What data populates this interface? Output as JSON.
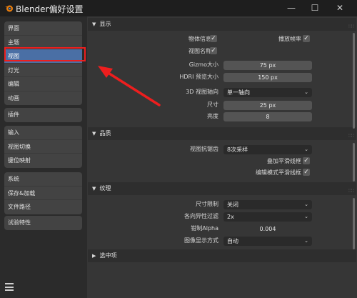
{
  "window": {
    "title": "Blender偏好设置",
    "min": "—",
    "max": "☐",
    "close": "✕"
  },
  "sidebar": {
    "groups": [
      [
        "界面",
        "主题",
        "视图",
        "灯光",
        "编辑",
        "动画"
      ],
      [
        "插件"
      ],
      [
        "输入",
        "视图切换",
        "键位映射"
      ],
      [
        "系统",
        "保存&加载",
        "文件路径"
      ],
      [
        "试验特性"
      ]
    ],
    "active": "视图"
  },
  "panels": {
    "display": {
      "title": "显示",
      "object_info": "物体信息",
      "playback_fps": "播放帧率",
      "view_name": "视图名称",
      "gizmo_size_label": "Gizmo大小",
      "gizmo_size_value": "75 px",
      "hdri_preview_label": "HDRI 预览大小",
      "hdri_preview_value": "150 px",
      "axis_3d_label": "3D 视图轴向",
      "axis_3d_value": "单一轴向",
      "size_label": "尺寸",
      "size_value": "25 px",
      "brightness_label": "亮度",
      "brightness_value": "8"
    },
    "quality": {
      "title": "品质",
      "viewport_aa_label": "视图抗锯齿",
      "viewport_aa_value": "8次采样",
      "overlay_smooth": "叠加平滑线框",
      "edit_smooth": "编辑模式平滑线框"
    },
    "texture": {
      "title": "纹理",
      "size_limit_label": "尺寸限制",
      "size_limit_value": "关闭",
      "anisotropic_label": "各向异性过滤",
      "anisotropic_value": "2x",
      "clip_alpha_label": "钳制Alpha",
      "clip_alpha_value": "0.004",
      "image_display_label": "图像显示方式",
      "image_display_value": "自动"
    },
    "selection": {
      "title": "选中项"
    }
  },
  "icons": {
    "check": "✓",
    "chevron": "⌄",
    "expanded": "▼",
    "collapsed": "▶",
    "grip": "∷∷"
  },
  "colors": {
    "annotation": "#ee1e1e",
    "active_item": "#4a6fa5"
  }
}
